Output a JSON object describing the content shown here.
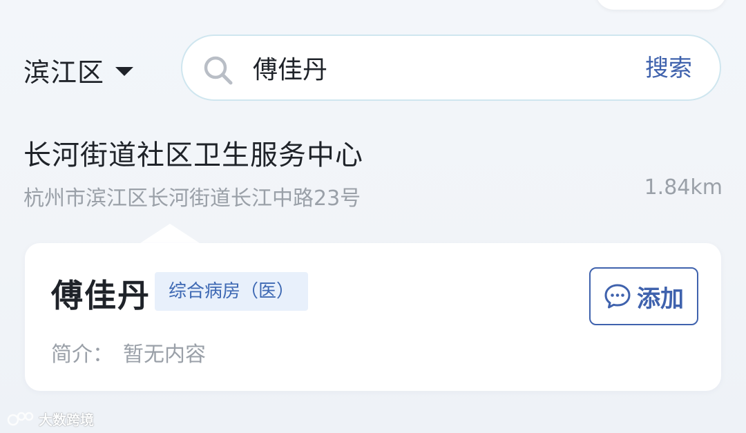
{
  "header": {
    "district": "滨江区",
    "search": {
      "value": "傅佳丹",
      "button_label": "搜索"
    }
  },
  "organization": {
    "name": "长河街道社区卫生服务中心",
    "address": "杭州市滨江区长河街道长江中路23号",
    "distance": "1.84km"
  },
  "doctor_card": {
    "name": "傅佳丹",
    "department": "综合病房（医）",
    "intro_label": "简介：",
    "intro_value": "暂无内容",
    "add_button_label": "添加"
  },
  "watermark": {
    "text": "大数跨境"
  },
  "colors": {
    "accent": "#3f62ad",
    "tag_bg": "#e8f0fb",
    "search_border": "#cfe6ef",
    "muted_text": "#9aa0a8"
  },
  "icons": {
    "search": "search-icon",
    "chat": "chat-bubble-icon",
    "dropdown": "caret-down-icon"
  }
}
